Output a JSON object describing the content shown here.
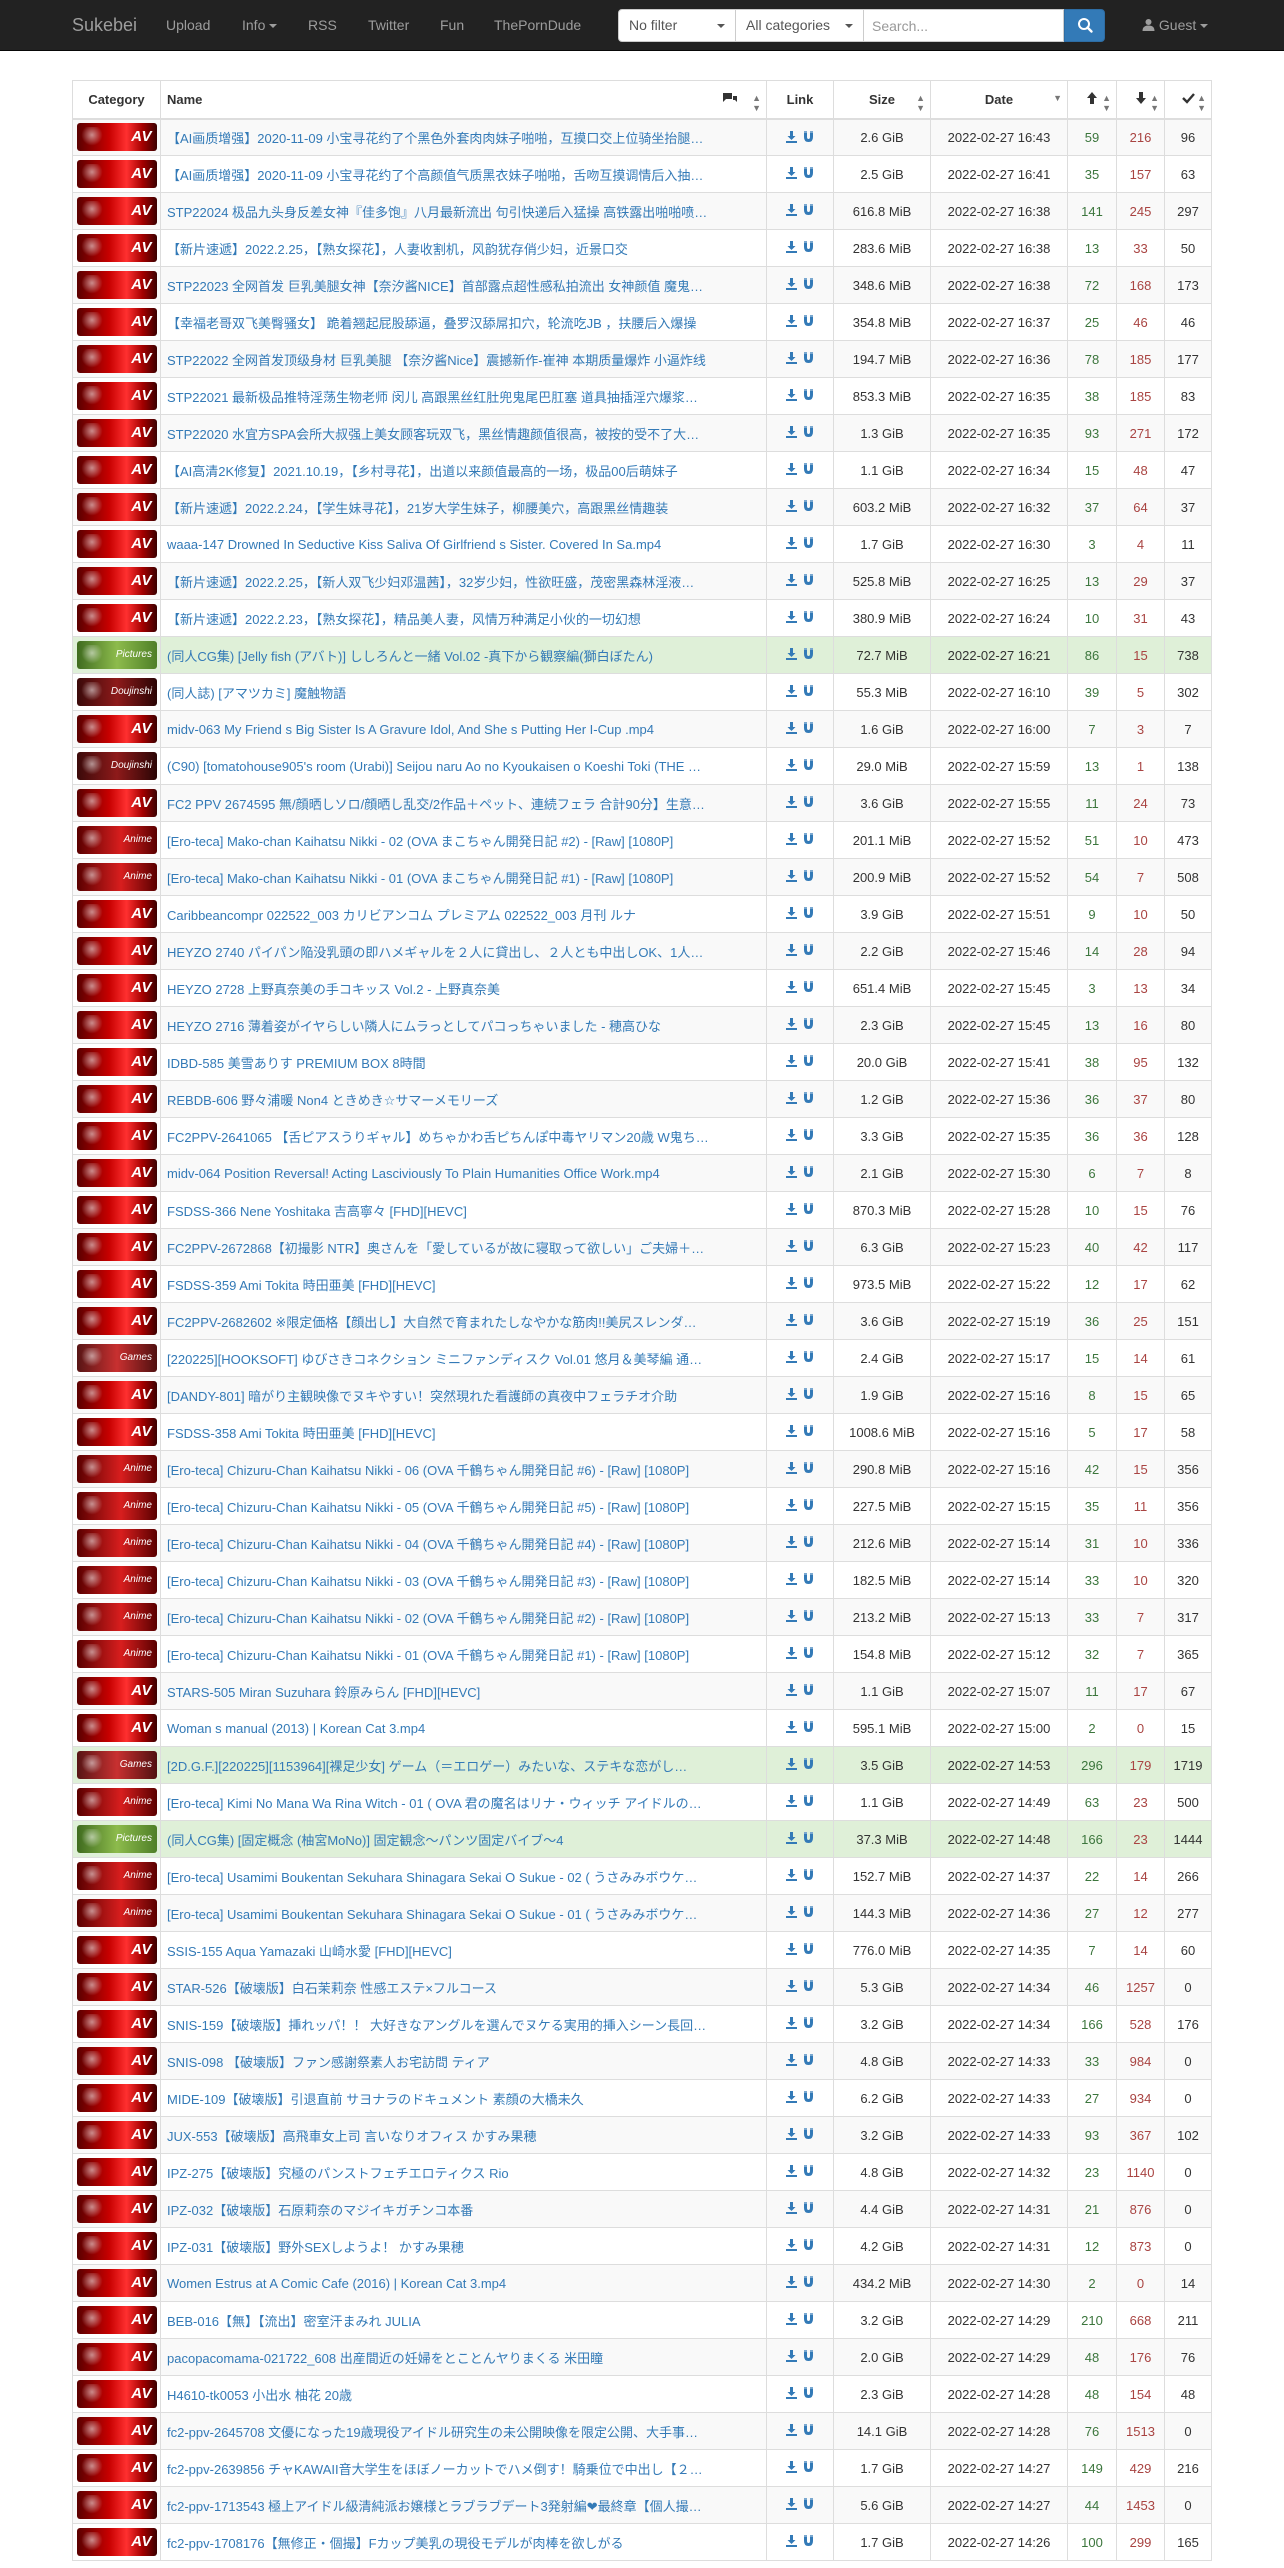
{
  "navbar": {
    "brand": "Sukebei",
    "items": [
      "Upload",
      "Info",
      "RSS",
      "Twitter",
      "Fun",
      "ThePornDude"
    ],
    "filter_value": "No filter",
    "category_value": "All categories",
    "search_placeholder": "Search...",
    "guest_label": "Guest"
  },
  "table": {
    "headers": {
      "category": "Category",
      "name": "Name",
      "link": "Link",
      "size": "Size",
      "date": "Date"
    },
    "rows": [
      {
        "cat": "AV",
        "name": "【AI画质增强】2020-11-09 小宝寻花约了个黑色外套肉肉妹子啪啪，互摸口交上位骑坐抬腿…",
        "size": "2.6 GiB",
        "date": "2022-02-27 16:43",
        "s": "59",
        "l": "216",
        "c": "96"
      },
      {
        "cat": "AV",
        "name": "【AI画质增强】2020-11-09 小宝寻花约了个高颜值气质黑衣妹子啪啪，舌吻互摸调情后入抽…",
        "size": "2.5 GiB",
        "date": "2022-02-27 16:41",
        "s": "35",
        "l": "157",
        "c": "63"
      },
      {
        "cat": "AV",
        "name": "STP22024 极品九头身反差女神『佳多饱』八月最新流出 句引快递后入猛操 高铁露出啪啪喷…",
        "size": "616.8 MiB",
        "date": "2022-02-27 16:38",
        "s": "141",
        "l": "245",
        "c": "297"
      },
      {
        "cat": "AV",
        "name": "【新片速遞】2022.2.25，【熟女探花】，人妻收割机，风韵犹存俏少妇，近景口交",
        "size": "283.6 MiB",
        "date": "2022-02-27 16:38",
        "s": "13",
        "l": "33",
        "c": "50"
      },
      {
        "cat": "AV",
        "name": "STP22023 全网首发 巨乳美腿女神【奈汐酱NICE】首部露点超性感私拍流出 女神颜值 魔鬼…",
        "size": "348.6 MiB",
        "date": "2022-02-27 16:38",
        "s": "72",
        "l": "168",
        "c": "173"
      },
      {
        "cat": "AV",
        "name": "【幸福老哥双飞美臀骚女】 跪着翘起屁股舔逼，叠罗汉舔屌扣穴，轮流吃JB ，扶腰后入爆操",
        "size": "354.8 MiB",
        "date": "2022-02-27 16:37",
        "s": "25",
        "l": "46",
        "c": "46"
      },
      {
        "cat": "AV",
        "name": "STP22022 全网首发顶级身材 巨乳美腿 【奈汐酱Nice】震撼新作-崔神 本期质量爆炸 小逼炸线",
        "size": "194.7 MiB",
        "date": "2022-02-27 16:36",
        "s": "78",
        "l": "185",
        "c": "177"
      },
      {
        "cat": "AV",
        "name": "STP22021 最新极品推特淫荡生物老师 闵儿 高跟黑丝红肚兜鬼尾巴肛塞 道具抽插淫穴爆浆…",
        "size": "853.3 MiB",
        "date": "2022-02-27 16:35",
        "s": "38",
        "l": "185",
        "c": "83"
      },
      {
        "cat": "AV",
        "name": "STP22020 水宜方SPA会所大叔强上美女顾客玩双飞，黑丝情趣颜值很高，被按的受不了大…",
        "size": "1.3 GiB",
        "date": "2022-02-27 16:35",
        "s": "93",
        "l": "271",
        "c": "172"
      },
      {
        "cat": "AV",
        "name": "【AI高清2K修复】2021.10.19，【乡村寻花】，出道以来颜值最高的一场，极品00后萌妹子",
        "size": "1.1 GiB",
        "date": "2022-02-27 16:34",
        "s": "15",
        "l": "48",
        "c": "47"
      },
      {
        "cat": "AV",
        "name": "【新片速遞】2022.2.24，【学生妹寻花】，21岁大学生妹子，柳腰美穴，高跟黑丝情趣装",
        "size": "603.2 MiB",
        "date": "2022-02-27 16:32",
        "s": "37",
        "l": "64",
        "c": "37"
      },
      {
        "cat": "AV",
        "name": "waaa-147 Drowned In Seductive Kiss Saliva Of Girlfriend s Sister. Covered In Sa.mp4",
        "size": "1.7 GiB",
        "date": "2022-02-27 16:30",
        "s": "3",
        "l": "4",
        "c": "11"
      },
      {
        "cat": "AV",
        "name": "【新片速遞】2022.2.25，【新人双飞少妇邓温茜】，32岁少妇，性欲旺盛，茂密黑森林淫液…",
        "size": "525.8 MiB",
        "date": "2022-02-27 16:25",
        "s": "13",
        "l": "29",
        "c": "37"
      },
      {
        "cat": "AV",
        "name": "【新片速遞】2022.2.23，【熟女探花】，精品美人妻，风情万种满足小伙的一切幻想",
        "size": "380.9 MiB",
        "date": "2022-02-27 16:24",
        "s": "10",
        "l": "31",
        "c": "43"
      },
      {
        "cat": "Pictures",
        "name": "(同人CG集) [Jelly fish (アバト)] ししろんと一緒 Vol.02 -真下から観察編(獅白ぼたん)",
        "size": "72.7 MiB",
        "date": "2022-02-27 16:21",
        "s": "86",
        "l": "15",
        "c": "738",
        "green": true
      },
      {
        "cat": "Doujinshi",
        "name": "(同人誌) [アマツカミ] 魔触物語",
        "size": "55.3 MiB",
        "date": "2022-02-27 16:10",
        "s": "39",
        "l": "5",
        "c": "302"
      },
      {
        "cat": "AV",
        "name": "midv-063 My Friend s Big Sister Is A Gravure Idol, And She s Putting Her I-Cup .mp4",
        "size": "1.6 GiB",
        "date": "2022-02-27 16:00",
        "s": "7",
        "l": "3",
        "c": "7"
      },
      {
        "cat": "Doujinshi",
        "name": "(C90) [tomatohouse905's room (Urabi)] Seijou naru Ao no Kyoukaisen o Koeshi Toki (THE …",
        "size": "29.0 MiB",
        "date": "2022-02-27 15:59",
        "s": "13",
        "l": "1",
        "c": "138"
      },
      {
        "cat": "AV",
        "name": "FC2 PPV 2674595 無/顔晒しソロ/顔晒し乱交/2作品＋ペット、連続フェラ 合計90分】生意…",
        "size": "3.6 GiB",
        "date": "2022-02-27 15:55",
        "s": "11",
        "l": "24",
        "c": "73"
      },
      {
        "cat": "Anime",
        "name": "[Ero-teca] Mako-chan Kaihatsu Nikki - 02 (OVA まこちゃん開発日記 #2) - [Raw] [1080P]",
        "size": "201.1 MiB",
        "date": "2022-02-27 15:52",
        "s": "51",
        "l": "10",
        "c": "473"
      },
      {
        "cat": "Anime",
        "name": "[Ero-teca] Mako-chan Kaihatsu Nikki - 01 (OVA まこちゃん開発日記 #1) - [Raw] [1080P]",
        "size": "200.9 MiB",
        "date": "2022-02-27 15:52",
        "s": "54",
        "l": "7",
        "c": "508"
      },
      {
        "cat": "AV",
        "name": "Caribbeancompr 022522_003 カリビアンコム プレミアム 022522_003 月刊 ルナ",
        "size": "3.9 GiB",
        "date": "2022-02-27 15:51",
        "s": "9",
        "l": "10",
        "c": "50"
      },
      {
        "cat": "AV",
        "name": "HEYZO 2740 パイパン陥没乳頭の即ハメギャルを２人に貸出し、２人とも中出しOK、1人…",
        "size": "2.2 GiB",
        "date": "2022-02-27 15:46",
        "s": "14",
        "l": "28",
        "c": "94"
      },
      {
        "cat": "AV",
        "name": "HEYZO 2728 上野真奈美の手コキッス Vol.2 - 上野真奈美",
        "size": "651.4 MiB",
        "date": "2022-02-27 15:45",
        "s": "3",
        "l": "13",
        "c": "34"
      },
      {
        "cat": "AV",
        "name": "HEYZO 2716 薄着姿がイヤらしい隣人にムラっとしてパコっちゃいました - 穂高ひな",
        "size": "2.3 GiB",
        "date": "2022-02-27 15:45",
        "s": "13",
        "l": "16",
        "c": "80"
      },
      {
        "cat": "AV",
        "name": "IDBD-585 美雪ありす PREMIUM BOX 8時間",
        "size": "20.0 GiB",
        "date": "2022-02-27 15:41",
        "s": "38",
        "l": "95",
        "c": "132"
      },
      {
        "cat": "AV",
        "name": "REBDB-606 野々浦暖 Non4 ときめき☆サマーメモリーズ",
        "size": "1.2 GiB",
        "date": "2022-02-27 15:36",
        "s": "36",
        "l": "37",
        "c": "80"
      },
      {
        "cat": "AV",
        "name": "FC2PPV-2641065 【舌ピアスうりギャル】めちゃかわ舌ピちんぽ中毒ヤリマン20歳 W鬼ち…",
        "size": "3.3 GiB",
        "date": "2022-02-27 15:35",
        "s": "36",
        "l": "36",
        "c": "128"
      },
      {
        "cat": "AV",
        "name": "midv-064 Position Reversal! Acting Lasciviously To Plain Humanities Office Work.mp4",
        "size": "2.1 GiB",
        "date": "2022-02-27 15:30",
        "s": "6",
        "l": "7",
        "c": "8"
      },
      {
        "cat": "AV",
        "name": "FSDSS-366 Nene Yoshitaka 吉高寧々 [FHD][HEVC]",
        "size": "870.3 MiB",
        "date": "2022-02-27 15:28",
        "s": "10",
        "l": "15",
        "c": "76"
      },
      {
        "cat": "AV",
        "name": "FC2PPV-2672868【初撮影 NTR】奥さんを「愛しているが故に寝取って欲しい」ご夫婦＋…",
        "size": "6.3 GiB",
        "date": "2022-02-27 15:23",
        "s": "40",
        "l": "42",
        "c": "117"
      },
      {
        "cat": "AV",
        "name": "FSDSS-359 Ami Tokita 時田亜美 [FHD][HEVC]",
        "size": "973.5 MiB",
        "date": "2022-02-27 15:22",
        "s": "12",
        "l": "17",
        "c": "62"
      },
      {
        "cat": "AV",
        "name": "FC2PPV-2682602 ※限定価格【顔出し】大自然で育まれたしなやかな筋肉!!美尻スレンダ…",
        "size": "3.6 GiB",
        "date": "2022-02-27 15:19",
        "s": "36",
        "l": "25",
        "c": "151"
      },
      {
        "cat": "Games",
        "name": "[220225][HOOKSOFT] ゆびさきコネクション ミニファンディスク Vol.01 悠月＆美琴編 通…",
        "size": "2.4 GiB",
        "date": "2022-02-27 15:17",
        "s": "15",
        "l": "14",
        "c": "61"
      },
      {
        "cat": "AV",
        "name": "[DANDY-801] 暗がり主観映像でヌキやすい！突然現れた看護師の真夜中フェラチオ介助",
        "size": "1.9 GiB",
        "date": "2022-02-27 15:16",
        "s": "8",
        "l": "15",
        "c": "65"
      },
      {
        "cat": "AV",
        "name": "FSDSS-358 Ami Tokita 時田亜美 [FHD][HEVC]",
        "size": "1008.6 MiB",
        "date": "2022-02-27 15:16",
        "s": "5",
        "l": "17",
        "c": "58"
      },
      {
        "cat": "Anime",
        "name": "[Ero-teca] Chizuru-Chan Kaihatsu Nikki - 06 (OVA 千鶴ちゃん開発日記 #6) - [Raw] [1080P]",
        "size": "290.8 MiB",
        "date": "2022-02-27 15:16",
        "s": "42",
        "l": "15",
        "c": "356"
      },
      {
        "cat": "Anime",
        "name": "[Ero-teca] Chizuru-Chan Kaihatsu Nikki - 05 (OVA 千鶴ちゃん開発日記 #5) - [Raw] [1080P]",
        "size": "227.5 MiB",
        "date": "2022-02-27 15:15",
        "s": "35",
        "l": "11",
        "c": "356"
      },
      {
        "cat": "Anime",
        "name": "[Ero-teca] Chizuru-Chan Kaihatsu Nikki - 04 (OVA 千鶴ちゃん開発日記 #4) - [Raw] [1080P]",
        "size": "212.6 MiB",
        "date": "2022-02-27 15:14",
        "s": "31",
        "l": "10",
        "c": "336"
      },
      {
        "cat": "Anime",
        "name": "[Ero-teca] Chizuru-Chan Kaihatsu Nikki - 03 (OVA 千鶴ちゃん開発日記 #3) - [Raw] [1080P]",
        "size": "182.5 MiB",
        "date": "2022-02-27 15:14",
        "s": "33",
        "l": "10",
        "c": "320"
      },
      {
        "cat": "Anime",
        "name": "[Ero-teca] Chizuru-Chan Kaihatsu Nikki - 02 (OVA 千鶴ちゃん開発日記 #2) - [Raw] [1080P]",
        "size": "213.2 MiB",
        "date": "2022-02-27 15:13",
        "s": "33",
        "l": "7",
        "c": "317"
      },
      {
        "cat": "Anime",
        "name": "[Ero-teca] Chizuru-Chan Kaihatsu Nikki - 01 (OVA 千鶴ちゃん開発日記 #1) - [Raw] [1080P]",
        "size": "154.8 MiB",
        "date": "2022-02-27 15:12",
        "s": "32",
        "l": "7",
        "c": "365"
      },
      {
        "cat": "AV",
        "name": "STARS-505 Miran Suzuhara 鈴原みらん [FHD][HEVC]",
        "size": "1.1 GiB",
        "date": "2022-02-27 15:07",
        "s": "11",
        "l": "17",
        "c": "67"
      },
      {
        "cat": "AV",
        "name": "Woman s manual (2013) | Korean Cat 3.mp4",
        "size": "595.1 MiB",
        "date": "2022-02-27 15:00",
        "s": "2",
        "l": "0",
        "c": "15"
      },
      {
        "cat": "Games",
        "name": "[2D.G.F.][220225][1153964][裸足少女] ゲーム（＝エロゲー）みたいな、ステキな恋がし…",
        "size": "3.5 GiB",
        "date": "2022-02-27 14:53",
        "s": "296",
        "l": "179",
        "c": "1719",
        "green": true
      },
      {
        "cat": "Anime",
        "name": "[Ero-teca] Kimi No Mana Wa Rina Witch - 01 ( OVA 君の魔名はリナ・ウィッチ アイドルの…",
        "size": "1.1 GiB",
        "date": "2022-02-27 14:49",
        "s": "63",
        "l": "23",
        "c": "500"
      },
      {
        "cat": "Pictures",
        "name": "(同人CG集) [固定概念 (柚宮MoNo)] 固定観念～パンツ固定バイブ～4",
        "size": "37.3 MiB",
        "date": "2022-02-27 14:48",
        "s": "166",
        "l": "23",
        "c": "1444",
        "green": true
      },
      {
        "cat": "Anime",
        "name": "[Ero-teca] Usamimi Boukentan Sekuhara Shinagara Sekai O Sukue - 02 ( うさみみボウケ…",
        "size": "152.7 MiB",
        "date": "2022-02-27 14:37",
        "s": "22",
        "l": "14",
        "c": "266"
      },
      {
        "cat": "Anime",
        "name": "[Ero-teca] Usamimi Boukentan Sekuhara Shinagara Sekai O Sukue - 01 ( うさみみボウケ…",
        "size": "144.3 MiB",
        "date": "2022-02-27 14:36",
        "s": "27",
        "l": "12",
        "c": "277"
      },
      {
        "cat": "AV",
        "name": "SSIS-155 Aqua Yamazaki 山崎水愛 [FHD][HEVC]",
        "size": "776.0 MiB",
        "date": "2022-02-27 14:35",
        "s": "7",
        "l": "14",
        "c": "60"
      },
      {
        "cat": "AV",
        "name": "STAR-526【破壊版】白石茉莉奈 性感エステ×フルコース",
        "size": "5.3 GiB",
        "date": "2022-02-27 14:34",
        "s": "46",
        "l": "1257",
        "c": "0"
      },
      {
        "cat": "AV",
        "name": "SNIS-159【破壊版】挿れッパ！！ 大好きなアングルを選んでヌケる実用的挿入シーン長回…",
        "size": "3.2 GiB",
        "date": "2022-02-27 14:34",
        "s": "166",
        "l": "528",
        "c": "176"
      },
      {
        "cat": "AV",
        "name": "SNIS-098 【破壊版】ファン感謝祭素人お宅訪問 ティア",
        "size": "4.8 GiB",
        "date": "2022-02-27 14:33",
        "s": "33",
        "l": "984",
        "c": "0"
      },
      {
        "cat": "AV",
        "name": "MIDE-109【破壊版】引退直前 サヨナラのドキュメント 素顔の大橋未久",
        "size": "6.2 GiB",
        "date": "2022-02-27 14:33",
        "s": "27",
        "l": "934",
        "c": "0"
      },
      {
        "cat": "AV",
        "name": "JUX-553【破壊版】高飛車女上司 言いなりオフィス かすみ果穂",
        "size": "3.2 GiB",
        "date": "2022-02-27 14:33",
        "s": "93",
        "l": "367",
        "c": "102"
      },
      {
        "cat": "AV",
        "name": "IPZ-275【破壊版】究極のパンストフェチエロティクス Rio",
        "size": "4.8 GiB",
        "date": "2022-02-27 14:32",
        "s": "23",
        "l": "1140",
        "c": "0"
      },
      {
        "cat": "AV",
        "name": "IPZ-032【破壊版】石原莉奈のマジイキガチンコ本番",
        "size": "4.4 GiB",
        "date": "2022-02-27 14:31",
        "s": "21",
        "l": "876",
        "c": "0"
      },
      {
        "cat": "AV",
        "name": "IPZ-031【破壊版】野外SEXしようよ！ かすみ果穂",
        "size": "4.2 GiB",
        "date": "2022-02-27 14:31",
        "s": "12",
        "l": "873",
        "c": "0"
      },
      {
        "cat": "AV",
        "name": "Women Estrus at A Comic Cafe (2016) | Korean Cat 3.mp4",
        "size": "434.2 MiB",
        "date": "2022-02-27 14:30",
        "s": "2",
        "l": "0",
        "c": "14"
      },
      {
        "cat": "AV",
        "name": "BEB-016【無】【流出】密室汗まみれ JULIA",
        "size": "3.2 GiB",
        "date": "2022-02-27 14:29",
        "s": "210",
        "l": "668",
        "c": "211"
      },
      {
        "cat": "AV",
        "name": "pacopacomama-021722_608 出産間近の妊婦をとことんヤりまくる 米田瞳",
        "size": "2.0 GiB",
        "date": "2022-02-27 14:29",
        "s": "48",
        "l": "176",
        "c": "76"
      },
      {
        "cat": "AV",
        "name": "H4610-tk0053 小出水 柚花 20歳",
        "size": "2.3 GiB",
        "date": "2022-02-27 14:28",
        "s": "48",
        "l": "154",
        "c": "48"
      },
      {
        "cat": "AV",
        "name": "fc2-ppv-2645708 文優になった19歳現役アイドル研究生の未公開映像を限定公開、大手事…",
        "size": "14.1 GiB",
        "date": "2022-02-27 14:28",
        "s": "76",
        "l": "1513",
        "c": "0"
      },
      {
        "cat": "AV",
        "name": "fc2-ppv-2639856 チャKAWAII音大学生をほぼノーカットでハメ倒す！騎乗位で中出し【２…",
        "size": "1.7 GiB",
        "date": "2022-02-27 14:27",
        "s": "149",
        "l": "429",
        "c": "216"
      },
      {
        "cat": "AV",
        "name": "fc2-ppv-1713543 極上アイドル級清純派お嬢様とラブラブデート3発射編❤最終章【個人撮…",
        "size": "5.6 GiB",
        "date": "2022-02-27 14:27",
        "s": "44",
        "l": "1453",
        "c": "0"
      },
      {
        "cat": "AV",
        "name": "fc2-ppv-1708176【無修正・個撮】Fカップ美乳の現役モデルが肉棒を欲しがる",
        "size": "1.7 GiB",
        "date": "2022-02-27 14:26",
        "s": "100",
        "l": "299",
        "c": "165"
      }
    ]
  }
}
